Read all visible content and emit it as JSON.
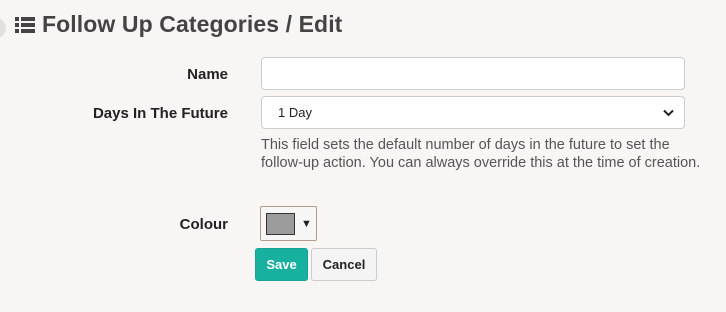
{
  "page": {
    "title": "Follow Up Categories / Edit",
    "title_icon": "list-icon"
  },
  "form": {
    "name": {
      "label": "Name",
      "value": "",
      "placeholder": ""
    },
    "days_in_future": {
      "label": "Days In The Future",
      "selected": "1 Day",
      "help_text": "This field sets the default number of days in the future to set the follow-up action. You can always override this at the time of creation."
    },
    "colour": {
      "label": "Colour",
      "value": "#9b9b9b",
      "arrow": "▼"
    }
  },
  "actions": {
    "save_label": "Save",
    "cancel_label": "Cancel"
  },
  "colors": {
    "save_button": "#18b09f",
    "background": "#f7f6f5"
  }
}
